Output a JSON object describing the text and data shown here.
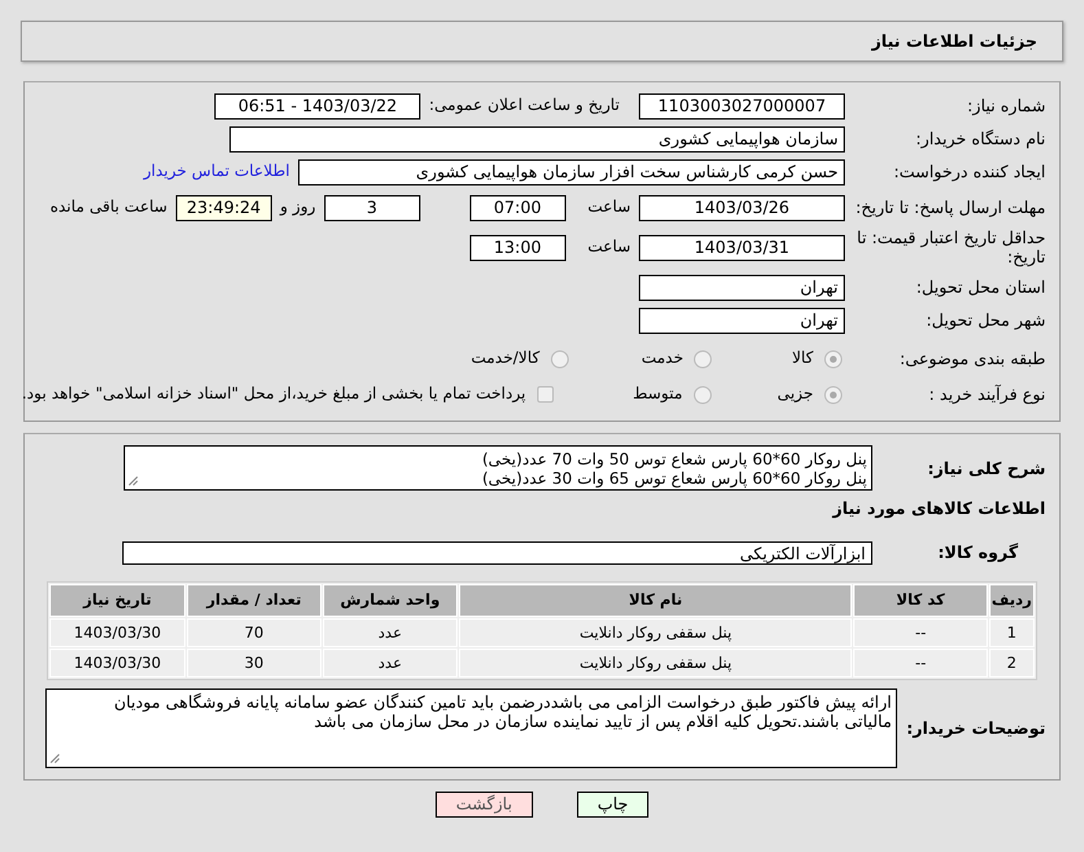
{
  "header": {
    "title": "جزئیات اطلاعات نیاز"
  },
  "need_number": {
    "label": "شماره نیاز:",
    "value": "1103003027000007"
  },
  "announce": {
    "label": "تاریخ و ساعت اعلان عمومی:",
    "value": "1403/03/22 - 06:51"
  },
  "buyer_org": {
    "label": "نام دستگاه خریدار:",
    "value": "سازمان هواپیمایی کشوری"
  },
  "requester": {
    "label": "ایجاد کننده درخواست:",
    "value": "حسن کرمی کارشناس سخت افزار سازمان هواپیمایی کشوری",
    "link": "اطلاعات تماس خریدار"
  },
  "reply_deadline": {
    "label": "مهلت ارسال پاسخ: تا تاریخ:",
    "date": "1403/03/26",
    "time_label": "ساعت",
    "time": "07:00",
    "days": "3",
    "days_label": "روز و",
    "remaining": "23:49:24",
    "remaining_label": "ساعت باقی مانده"
  },
  "price_validity": {
    "label": "حداقل تاریخ اعتبار قیمت: تا تاریخ:",
    "date": "1403/03/31",
    "time_label": "ساعت",
    "time": "13:00"
  },
  "province": {
    "label": "استان محل تحویل:",
    "value": "تهران"
  },
  "city": {
    "label": "شهر محل تحویل:",
    "value": "تهران"
  },
  "category": {
    "label": "طبقه بندی موضوعی:",
    "options": [
      {
        "kind": "radio",
        "label": "کالا",
        "selected": true
      },
      {
        "kind": "radio",
        "label": "خدمت",
        "selected": false
      },
      {
        "kind": "radio",
        "label": "کالا/خدمت",
        "selected": false
      }
    ]
  },
  "process": {
    "label": "نوع فرآیند خرید :",
    "options": [
      {
        "kind": "radio",
        "label": "جزیی",
        "selected": true
      },
      {
        "kind": "radio",
        "label": "متوسط",
        "selected": false
      },
      {
        "kind": "checkbox",
        "label": "پرداخت تمام یا بخشی از مبلغ خرید،از محل \"اسناد خزانه اسلامی\" خواهد بود.",
        "selected": false
      }
    ]
  },
  "description": {
    "label": "شرح کلی نیاز:",
    "lines": [
      "پنل روکار 60*60 پارس شعاع توس 50 وات 70 عدد(یخی)",
      "پنل روکار 60*60 پارس شعاع توس 65 وات 30 عدد(یخی)"
    ]
  },
  "goods_title": "اطلاعات کالاهای مورد نیاز",
  "goods_group": {
    "label": "گروه کالا:",
    "value": "ابزارآلات الکتریکی"
  },
  "table": {
    "columns": [
      "ردیف",
      "کد کالا",
      "نام کالا",
      "واحد شمارش",
      "تعداد / مقدار",
      "تاریخ نیاز"
    ],
    "rows": [
      [
        "1",
        "--",
        "پنل سقفی روکار دانلایت",
        "عدد",
        "70",
        "1403/03/30"
      ],
      [
        "2",
        "--",
        "پنل سقفی روکار دانلایت",
        "عدد",
        "30",
        "1403/03/30"
      ]
    ]
  },
  "buyer_notes": {
    "label": "توضیحات خریدار:",
    "text": "ارائه پیش فاکتور طبق درخواست الزامی می باشددرضمن باید تامین کنندگان عضو سامانه پایانه فروشگاهی مودیان مالیاتی باشند.تحویل کلیه اقلام پس از تایید نماینده سازمان در محل سازمان می باشد"
  },
  "buttons": [
    {
      "kind": "print",
      "label": "چاپ"
    },
    {
      "kind": "back",
      "label": "بازگشت"
    }
  ]
}
